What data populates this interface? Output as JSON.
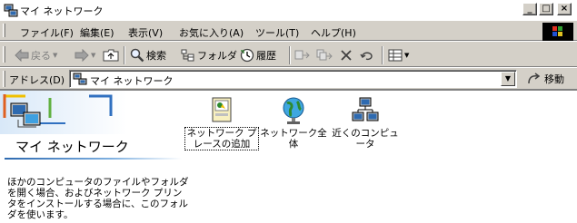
{
  "window": {
    "title": "マイ ネットワーク",
    "minimize_label": "_",
    "maximize_label": "□",
    "close_label": "×"
  },
  "menu": {
    "items": [
      {
        "label": "ファイル(F)"
      },
      {
        "label": "編集(E)"
      },
      {
        "label": "表示(V)"
      },
      {
        "label": "お気に入り(A)"
      },
      {
        "label": "ツール(T)"
      },
      {
        "label": "ヘルプ(H)"
      }
    ]
  },
  "toolbar": {
    "back_label": "戻る",
    "search_label": "検索",
    "folders_label": "フォルダ",
    "history_label": "履歴"
  },
  "address": {
    "label": "アドレス(D)",
    "value": "マイ ネットワーク",
    "go_label": "移動"
  },
  "panel": {
    "title": "マイ ネットワーク",
    "description": "ほかのコンピュータのファイルやフォルダを開く場合、およびネットワーク プリンタをインストールする場合に、このフォルダを使います。"
  },
  "items": [
    {
      "label": "ネットワーク プレースの追加",
      "icon": "add-network-place-icon"
    },
    {
      "label": "ネットワーク全体",
      "icon": "globe-icon"
    },
    {
      "label": "近くのコンピュータ",
      "icon": "computers-near-me-icon"
    }
  ],
  "colors": {
    "window_bg": "#d4d0c8",
    "content_bg": "#ffffff",
    "accent_blue": "#2e6ab0"
  }
}
